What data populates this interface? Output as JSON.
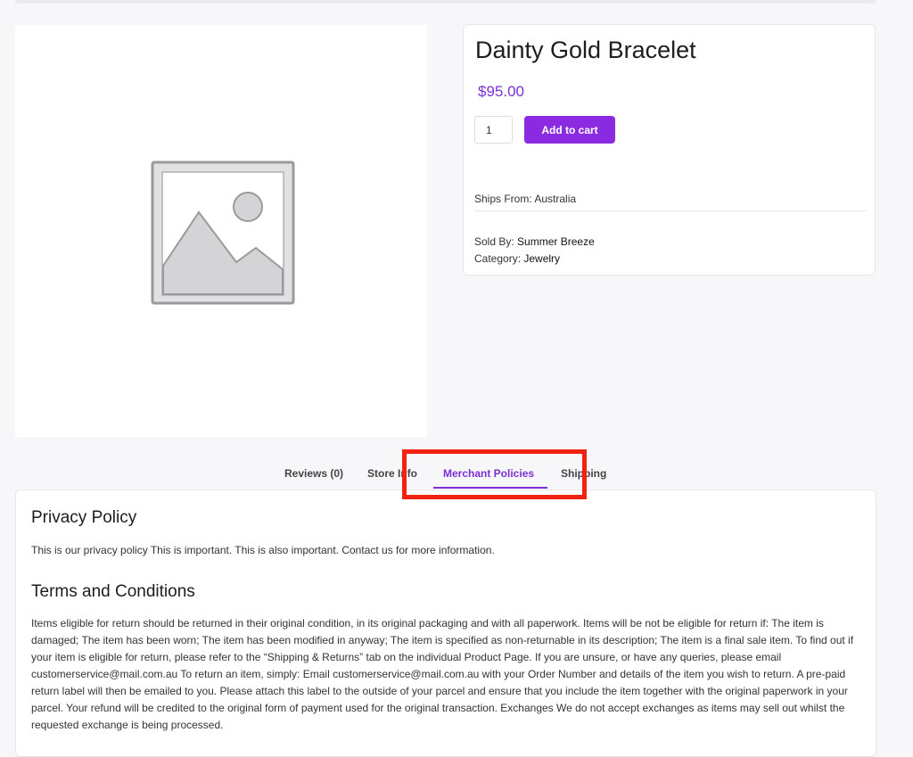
{
  "product": {
    "title": "Dainty Gold Bracelet",
    "price": "$95.00",
    "quantity": "1",
    "add_to_cart_label": "Add to cart",
    "ships_from": "Ships From: Australia",
    "sold_by_label": "Sold By:",
    "sold_by_value": "Summer Breeze",
    "category_label": "Category:",
    "category_value": "Jewelry",
    "image_icon": "image-placeholder-icon"
  },
  "tabs": [
    {
      "label": "Reviews (0)",
      "active": false
    },
    {
      "label": "Store Info",
      "active": false
    },
    {
      "label": "Merchant Policies",
      "active": true
    },
    {
      "label": "Shipping",
      "active": false
    }
  ],
  "policies": {
    "privacy_heading": "Privacy Policy",
    "privacy_text": "This is our privacy policy This is important. This is also important. Contact us for more information.",
    "terms_heading": "Terms and Conditions",
    "terms_text": "Items eligible for return should be returned in their original condition, in its original packaging and with all paperwork. Items will be not be eligible for return if: The item is damaged; The item has been worn; The item has been modified in anyway; The item is specified as non-returnable in its description; The item is a final sale item. To find out if your item is eligible for return, please refer to the “Shipping & Returns” tab on the individual Product Page. If you are unsure, or have any queries, please email customerservice@mail.com.au To return an item, simply: Email customerservice@mail.com.au with your Order Number and details of the item you wish to return. A pre-paid return label will then be emailed to you. Please attach this label to the outside of your parcel and ensure that you include the item together with the original paperwork in your parcel. Your refund will be credited to the original form of payment used for the original transaction. Exchanges We do not accept exchanges as items may sell out whilst the requested exchange is being processed."
  },
  "colors": {
    "accent": "#8a2be2",
    "price": "#7b2fd4",
    "highlight": "#f1220f",
    "background": "#f7f7f9"
  }
}
